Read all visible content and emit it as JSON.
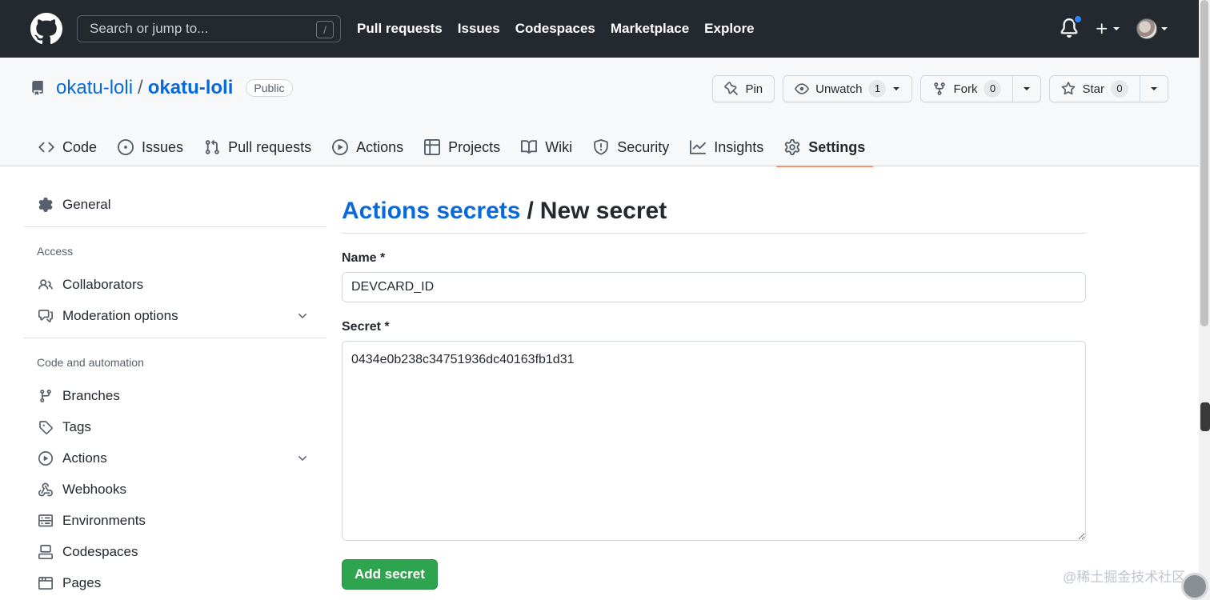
{
  "header": {
    "search_placeholder": "Search or jump to...",
    "search_shortcut": "/",
    "nav": [
      "Pull requests",
      "Issues",
      "Codespaces",
      "Marketplace",
      "Explore"
    ]
  },
  "repo": {
    "owner": "okatu-loli",
    "separator": "/",
    "name": "okatu-loli",
    "visibility": "Public",
    "pin_label": "Pin",
    "unwatch_label": "Unwatch",
    "watch_count": "1",
    "fork_label": "Fork",
    "fork_count": "0",
    "star_label": "Star",
    "star_count": "0",
    "tabs": [
      "Code",
      "Issues",
      "Pull requests",
      "Actions",
      "Projects",
      "Wiki",
      "Security",
      "Insights",
      "Settings"
    ],
    "selected_tab": "Settings"
  },
  "sidebar": {
    "general": "General",
    "access_heading": "Access",
    "access_items": [
      "Collaborators",
      "Moderation options"
    ],
    "code_heading": "Code and automation",
    "code_items": [
      "Branches",
      "Tags",
      "Actions",
      "Webhooks",
      "Environments",
      "Codespaces",
      "Pages"
    ]
  },
  "main": {
    "breadcrumb": "Actions secrets",
    "breadcrumb_sep": "/",
    "title": "New secret",
    "name_label": "Name *",
    "name_value": "DEVCARD_ID",
    "secret_label": "Secret *",
    "secret_value": "0434e0b238c34751936dc40163fb1d31",
    "submit_label": "Add secret"
  },
  "watermark": "@稀土掘金技术社区",
  "colors": {
    "header_bg": "#24292f",
    "link": "#0969da",
    "primary": "#2da44e",
    "tab_underline": "#fd8c73",
    "notification_dot": "#2f81f7"
  }
}
